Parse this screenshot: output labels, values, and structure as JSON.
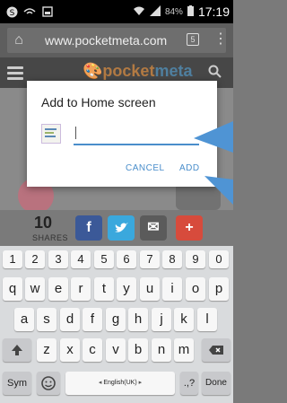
{
  "status": {
    "battery_text": "84%",
    "clock": "17:19"
  },
  "browser": {
    "url": "www.pocketmeta.com",
    "tabs_count": "5"
  },
  "site": {
    "logo_part1": "pocket",
    "logo_part2": "meta"
  },
  "shares": {
    "count": "10",
    "label": "SHARES",
    "buttons": [
      {
        "name": "facebook",
        "glyph": "f",
        "color": "#3b5998"
      },
      {
        "name": "twitter",
        "glyph": "🐦",
        "color": "#3aa8dd"
      },
      {
        "name": "email",
        "glyph": "✉",
        "color": "#5b5b5b"
      },
      {
        "name": "more",
        "glyph": "+",
        "color": "#d74b3c"
      }
    ]
  },
  "dialog": {
    "title": "Add to Home screen",
    "input_value": "",
    "cancel_label": "CANCEL",
    "add_label": "ADD"
  },
  "keyboard": {
    "number_row": [
      "1",
      "2",
      "3",
      "4",
      "5",
      "6",
      "7",
      "8",
      "9",
      "0"
    ],
    "row1": [
      "q",
      "w",
      "e",
      "r",
      "t",
      "y",
      "u",
      "i",
      "o",
      "p"
    ],
    "row2": [
      "a",
      "s",
      "d",
      "f",
      "g",
      "h",
      "j",
      "k",
      "l"
    ],
    "row3": [
      "z",
      "x",
      "c",
      "v",
      "b",
      "n",
      "m"
    ],
    "sym_label": "Sym",
    "space_label": "English(UK)",
    "done_label": "Done",
    "punct_label": ".,?"
  },
  "colors": {
    "accent": "#4a8ecb",
    "arrow": "#4f94d4"
  }
}
